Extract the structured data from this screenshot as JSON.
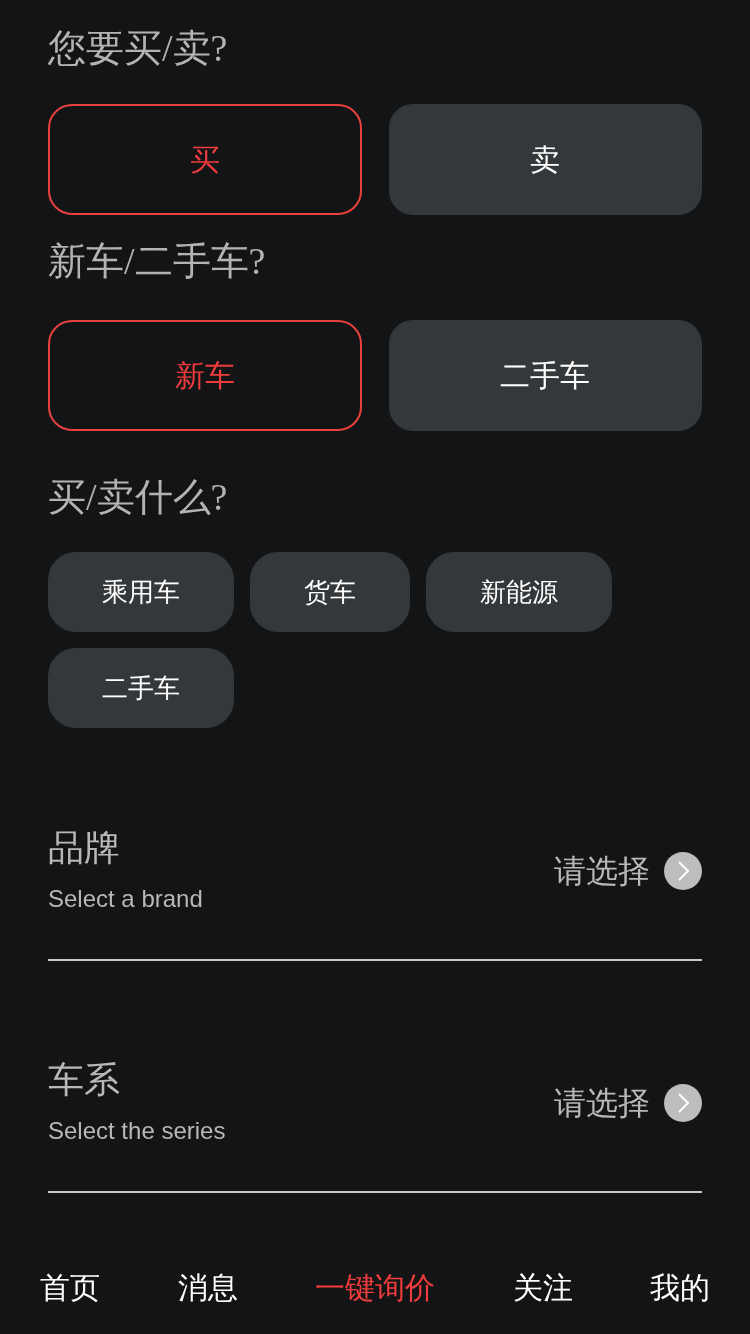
{
  "questions": [
    {
      "kind": "pair",
      "title": "您要买/卖?",
      "options": [
        {
          "label": "买",
          "selected": true
        },
        {
          "label": "卖",
          "selected": false
        }
      ]
    },
    {
      "kind": "pair",
      "title": "新车/二手车?",
      "options": [
        {
          "label": "新车",
          "selected": true
        },
        {
          "label": "二手车",
          "selected": false
        }
      ]
    },
    {
      "kind": "chips",
      "title": "买/卖什么?",
      "options": [
        {
          "label": "乘用车",
          "selected": false
        },
        {
          "label": "货车",
          "selected": false
        },
        {
          "label": "新能源",
          "selected": false
        },
        {
          "label": "二手车",
          "selected": false
        }
      ]
    }
  ],
  "fields": [
    {
      "title": "品牌",
      "subtitle": "Select a brand",
      "value": "请选择"
    },
    {
      "title": "车系",
      "subtitle": "Select the series",
      "value": "请选择"
    }
  ],
  "nav": [
    {
      "label": "首页",
      "selected": false
    },
    {
      "label": "消息",
      "selected": false
    },
    {
      "label": "一键询价",
      "selected": true
    },
    {
      "label": "关注",
      "selected": false
    },
    {
      "label": "我的",
      "selected": false
    }
  ]
}
